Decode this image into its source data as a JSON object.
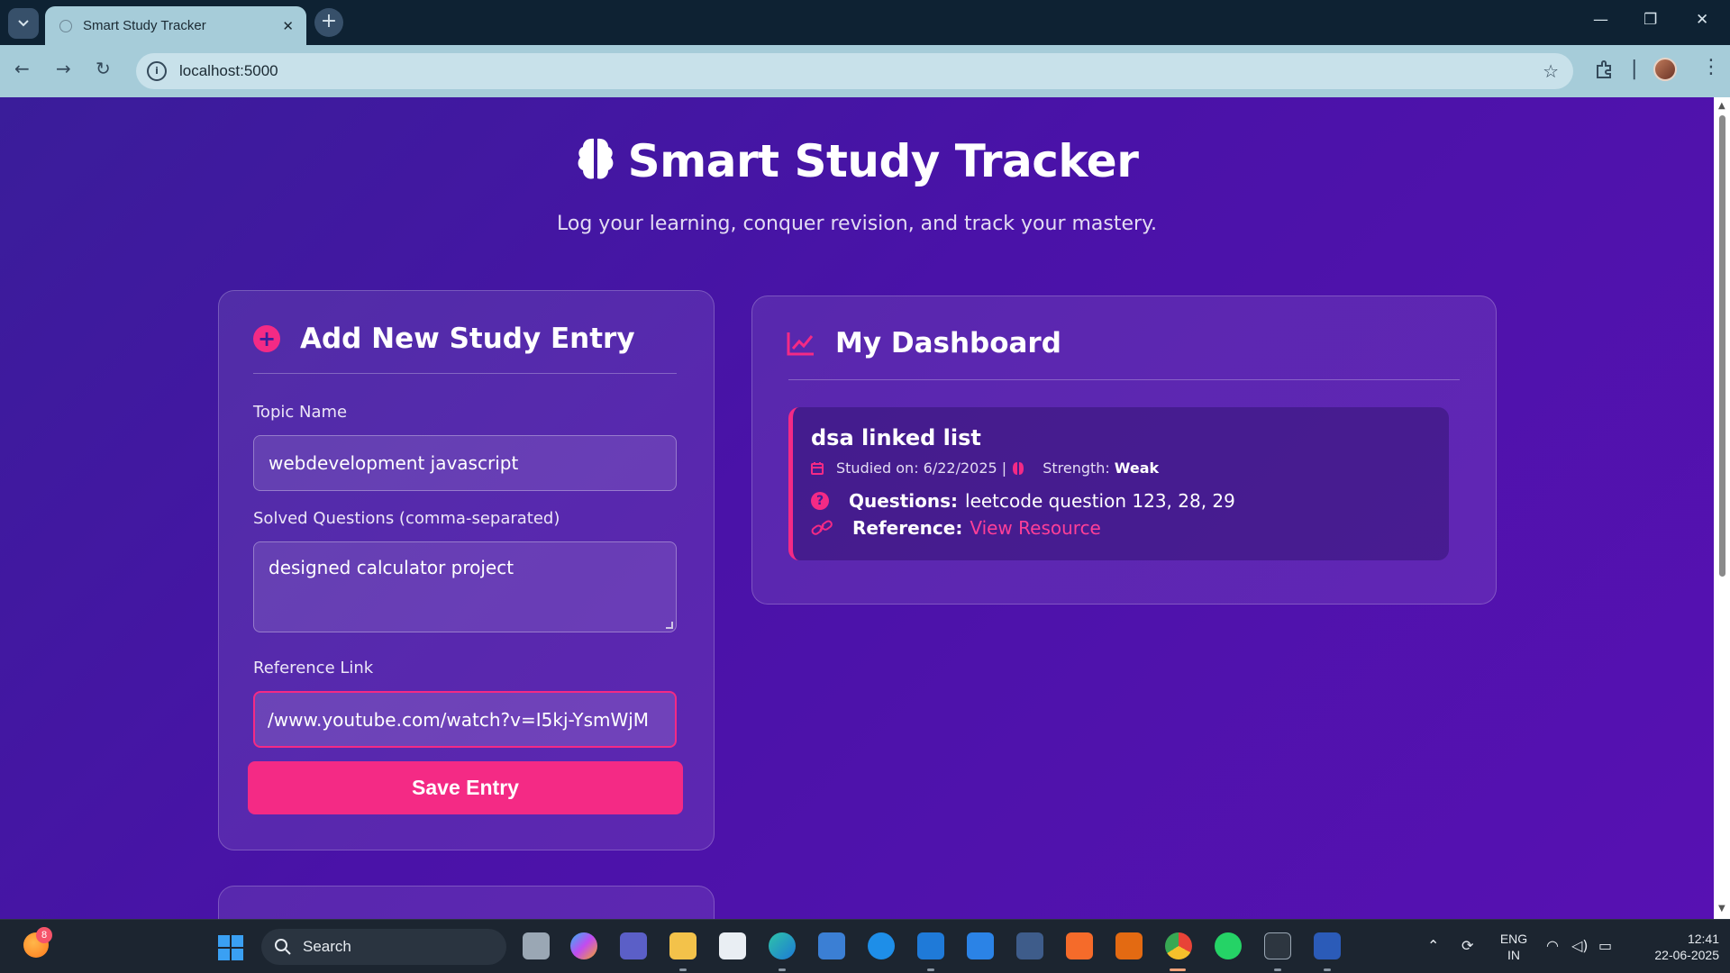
{
  "browser": {
    "tab_title": "Smart Study Tracker",
    "tab_close": "✕",
    "new_tab": "+",
    "url": "localhost:5000",
    "window_controls": {
      "minimize": "—",
      "restore": "❐",
      "close": "✕"
    }
  },
  "header": {
    "title": "Smart Study Tracker",
    "subtitle": "Log your learning, conquer revision, and track your mastery."
  },
  "form": {
    "heading": "Add New Study Entry",
    "topic_label": "Topic Name",
    "topic_value": "webdevelopment  javascript",
    "questions_label": "Solved Questions (comma-separated)",
    "questions_value": "designed calculator project",
    "reference_label": "Reference Link",
    "reference_value": "/www.youtube.com/watch?v=I5kj-YsmWjM",
    "save_label": "Save Entry"
  },
  "dashboard": {
    "heading": "My Dashboard",
    "entries": [
      {
        "title": "dsa linked list",
        "studied_on": "Studied on: 6/22/2025 |",
        "strength_label": "Strength:",
        "strength_value": "Weak",
        "questions_label": "Questions:",
        "questions_value": "leetcode question 123, 28, 29",
        "reference_label": "Reference:",
        "reference_link": "View Resource"
      }
    ]
  },
  "taskbar": {
    "notification_count": "8",
    "search_label": "Search",
    "lang_top": "ENG",
    "lang_bottom": "IN",
    "time": "12:41",
    "date": "22-06-2025"
  },
  "colors": {
    "accent": "#f42a85",
    "page_bg_start": "#3a1d9a",
    "page_bg_end": "#5711b2",
    "chrome_bg": "#a6ccd9"
  }
}
